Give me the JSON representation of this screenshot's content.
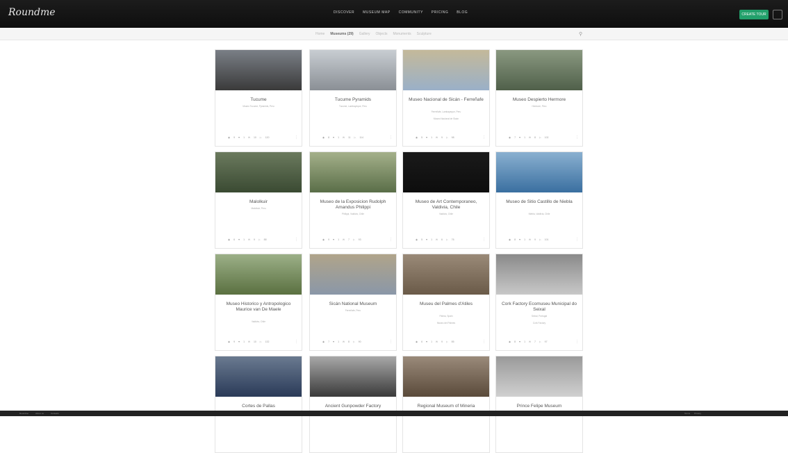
{
  "header": {
    "logo": "Roundme",
    "nav": [
      "DISCOVER",
      "MUSEUM MAP",
      "COMMUNITY",
      "PRICING",
      "BLOG"
    ],
    "create_label": "CREATE TOUR"
  },
  "subbar": {
    "filters": [
      "Home",
      "Museums (29)",
      "Gallery",
      "Objects",
      "Monuments",
      "Sculpture"
    ],
    "active_index": 1
  },
  "cards": [
    {
      "title": "Tucume",
      "desc": "Museo Tucume, Pyramids, Peru",
      "desc2": "",
      "colors": [
        "#3a3a3a",
        "#7a7f86"
      ],
      "stats": [
        "9",
        "1",
        "10",
        "120"
      ]
    },
    {
      "title": "Tucume Pyramids",
      "desc": "Tucume, Lambayeque, Peru",
      "desc2": "",
      "colors": [
        "#8a8f95",
        "#c8cdd2"
      ],
      "stats": [
        "8",
        "1",
        "11",
        "114"
      ]
    },
    {
      "title": "Museo Nacional de Sicán - Ferreñafe",
      "desc": "Ferreñafe, Lambayeque, Peru",
      "desc2": "Museo Nacional de Sicán",
      "colors": [
        "#9ab0c8",
        "#c4b99a"
      ],
      "stats": [
        "5",
        "1",
        "9",
        "98"
      ]
    },
    {
      "title": "Museo Despierto Hermore",
      "desc": "Hermore, Peru",
      "desc2": "",
      "colors": [
        "#50604a",
        "#8a9880"
      ],
      "stats": [
        "7",
        "1",
        "8",
        "102"
      ]
    },
    {
      "title": "Malolkuir",
      "desc": "Malolkuir, Peru",
      "desc2": "",
      "colors": [
        "#3a4a32",
        "#6b7a5e"
      ],
      "stats": [
        "6",
        "1",
        "9",
        "88"
      ]
    },
    {
      "title": "Museo de la Exposicion Rudolph Amandus Philippi",
      "desc": "Philippi, Valdivia, Chile",
      "desc2": "",
      "colors": [
        "#5a6e48",
        "#a4b08a"
      ],
      "stats": [
        "9",
        "1",
        "7",
        "93"
      ]
    },
    {
      "title": "Museo de Art Contemporaneo, Valdivia, Chile",
      "desc": "Valdivia, Chile",
      "desc2": "",
      "colors": [
        "#0d0d0d",
        "#1a1a1a"
      ],
      "stats": [
        "5",
        "1",
        "6",
        "76"
      ]
    },
    {
      "title": "Museo de Sitio Castillo de Niebla",
      "desc": "Niebla, Valdivia, Chile",
      "desc2": "",
      "colors": [
        "#3a6fa0",
        "#8ab0d0"
      ],
      "stats": [
        "8",
        "1",
        "9",
        "101"
      ]
    },
    {
      "title": "Museo Historico y Antropologico Maurice van De Maele",
      "desc": "Valdivia, Chile",
      "desc2": "",
      "colors": [
        "#5a7040",
        "#9cb088"
      ],
      "stats": [
        "9",
        "1",
        "10",
        "132"
      ]
    },
    {
      "title": "Sicán National Museum",
      "desc": "Ferreñafe, Peru",
      "desc2": "",
      "colors": [
        "#8a97a8",
        "#b0a48a"
      ],
      "stats": [
        "7",
        "1",
        "8",
        "90"
      ]
    },
    {
      "title": "Museu del Palmes d'Atiles",
      "desc": "Palma, Spain",
      "desc2": "Museu del Palmes",
      "colors": [
        "#6a5a48",
        "#9a8a78"
      ],
      "stats": [
        "6",
        "1",
        "9",
        "85"
      ]
    },
    {
      "title": "Cork Factory Ecomuseu Municipal do Seixal",
      "desc": "Seixal, Portugal",
      "desc2": "Cork Factory",
      "colors": [
        "#c8c8c8",
        "#8a8a8a"
      ],
      "stats": [
        "8",
        "1",
        "7",
        "97"
      ]
    },
    {
      "title": "Cortes de Pallas",
      "desc": "",
      "desc2": "",
      "colors": [
        "#2a3a58",
        "#6a7a90"
      ],
      "stats": [
        "",
        "",
        "",
        ""
      ]
    },
    {
      "title": "Ancient Gunpowder Factory",
      "desc": "",
      "desc2": "",
      "colors": [
        "#3a3a3a",
        "#a8a8a8"
      ],
      "stats": [
        "",
        "",
        "",
        ""
      ]
    },
    {
      "title": "Regional Museum of Mineria",
      "desc": "",
      "desc2": "",
      "colors": [
        "#5a4a3a",
        "#9a8a7a"
      ],
      "stats": [
        "",
        "",
        "",
        ""
      ]
    },
    {
      "title": "Prince Felipe Museum",
      "desc": "",
      "desc2": "",
      "colors": [
        "#d0d0d0",
        "#9a9a9a"
      ],
      "stats": [
        "",
        "",
        "",
        ""
      ]
    }
  ],
  "footer": {
    "left": [
      "Roundme",
      "About us",
      "Contacts"
    ],
    "right": [
      "Terms",
      "Privacy"
    ]
  }
}
